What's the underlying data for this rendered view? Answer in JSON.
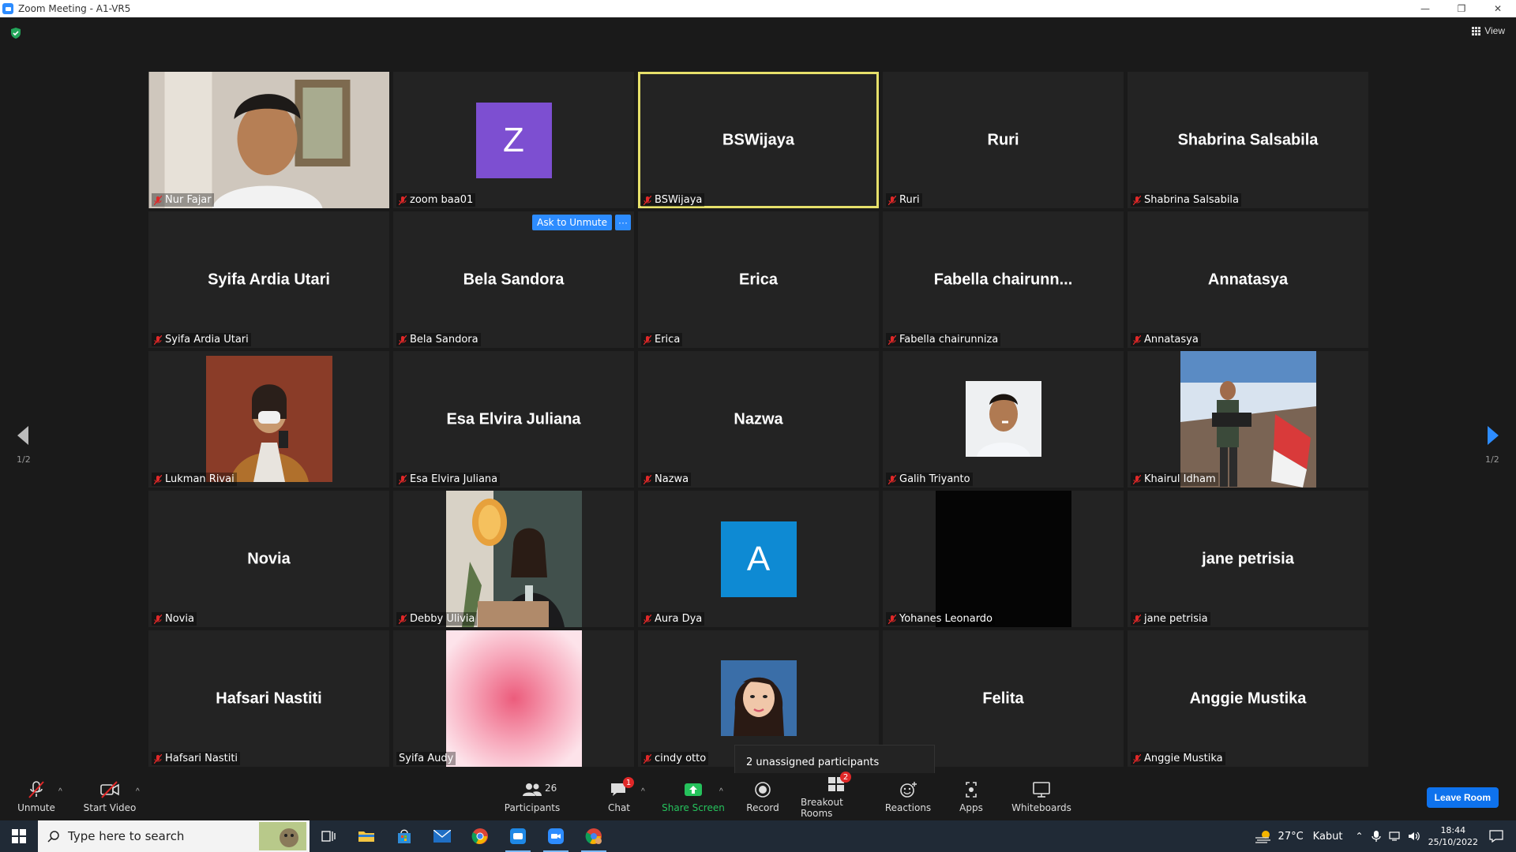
{
  "window": {
    "title": "Zoom Meeting - A1-VR5"
  },
  "header": {
    "view_label": "View"
  },
  "pagination": {
    "left_page": "1/2",
    "right_page": "1/2"
  },
  "tiles": [
    {
      "big": "",
      "label": "Nur Fajar",
      "type": "video"
    },
    {
      "big": "",
      "label": "zoom baa01",
      "type": "letter",
      "letter": "Z",
      "color": "#7d4fd1"
    },
    {
      "big": "BSWijaya",
      "label": "BSWijaya",
      "type": "name",
      "active": true
    },
    {
      "big": "Ruri",
      "label": "Ruri",
      "type": "name"
    },
    {
      "big": "Shabrina Salsabila",
      "label": "Shabrina Salsabila",
      "type": "name"
    },
    {
      "big": "Syifa Ardia Utari",
      "label": "Syifa Ardia Utari",
      "type": "name"
    },
    {
      "big": "Bela Sandora",
      "label": "Bela Sandora",
      "type": "name"
    },
    {
      "big": "Erica",
      "label": "Erica",
      "type": "name"
    },
    {
      "big": "Fabella  chairunn...",
      "label": "Fabella chairunniza",
      "type": "name"
    },
    {
      "big": "Annatasya",
      "label": "Annatasya",
      "type": "name"
    },
    {
      "big": "",
      "label": "Lukman Rivai",
      "type": "photo"
    },
    {
      "big": "Esa Elvira Juliana",
      "label": "Esa Elvira Juliana",
      "type": "name"
    },
    {
      "big": "Nazwa",
      "label": "Nazwa",
      "type": "name"
    },
    {
      "big": "",
      "label": "Galih Triyanto",
      "type": "photo"
    },
    {
      "big": "",
      "label": "Khairul Idham",
      "type": "photo"
    },
    {
      "big": "Novia",
      "label": "Novia",
      "type": "name"
    },
    {
      "big": "",
      "label": "Debby Ulivia",
      "type": "photo"
    },
    {
      "big": "",
      "label": "Aura Dya",
      "type": "letter",
      "letter": "A",
      "color": "#0e8ad3"
    },
    {
      "big": "",
      "label": "Yohanes Leonardo",
      "type": "photo"
    },
    {
      "big": "jane petrisia",
      "label": "jane petrisia",
      "type": "name"
    },
    {
      "big": "Hafsari Nastiti",
      "label": "Hafsari Nastiti",
      "type": "name"
    },
    {
      "big": "",
      "label": "Syifa Audy",
      "type": "photo"
    },
    {
      "big": "",
      "label": "cindy otto",
      "type": "photo"
    },
    {
      "big": "Felita",
      "label": "",
      "type": "name"
    },
    {
      "big": "Anggie Mustika",
      "label": "Anggie Mustika",
      "type": "name"
    }
  ],
  "hover_actions": {
    "ask_to_unmute": "Ask to Unmute",
    "more": "···"
  },
  "tooltip": {
    "text": "2 unassigned participants"
  },
  "toolbar": {
    "unmute": "Unmute",
    "start_video": "Start Video",
    "participants": "Participants",
    "participants_count": "26",
    "chat": "Chat",
    "chat_badge": "1",
    "share_screen": "Share Screen",
    "record": "Record",
    "breakout_rooms": "Breakout Rooms",
    "breakout_badge": "2",
    "reactions": "Reactions",
    "apps": "Apps",
    "whiteboards": "Whiteboards",
    "leave_room": "Leave Room"
  },
  "taskbar": {
    "search_placeholder": "Type here to search",
    "weather_temp": "27°C",
    "weather_desc": "Kabut",
    "time": "18:44",
    "date": "25/10/2022"
  },
  "colors": {
    "accent": "#2d8cff",
    "active_speaker": "#e6e06a",
    "share_green": "#25c25c",
    "leave_blue": "#0e72ed",
    "muted_red": "#e02828"
  }
}
